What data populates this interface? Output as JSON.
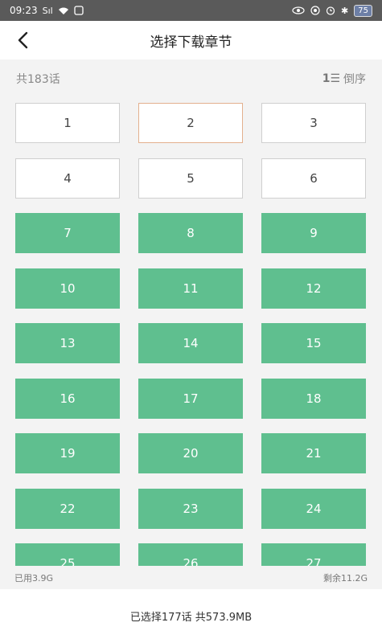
{
  "status_bar": {
    "time": "09:23",
    "signal": "Sıl",
    "battery": "75"
  },
  "header": {
    "title": "选择下载章节"
  },
  "info": {
    "total": "共183话",
    "sort_label": "倒序",
    "sort_icon_text": "1☰"
  },
  "chapters": [
    {
      "label": "1",
      "state": "default"
    },
    {
      "label": "2",
      "state": "selected-outline"
    },
    {
      "label": "3",
      "state": "default"
    },
    {
      "label": "4",
      "state": "default"
    },
    {
      "label": "5",
      "state": "default"
    },
    {
      "label": "6",
      "state": "default"
    },
    {
      "label": "7",
      "state": "downloaded"
    },
    {
      "label": "8",
      "state": "downloaded"
    },
    {
      "label": "9",
      "state": "downloaded"
    },
    {
      "label": "10",
      "state": "downloaded"
    },
    {
      "label": "11",
      "state": "downloaded"
    },
    {
      "label": "12",
      "state": "downloaded"
    },
    {
      "label": "13",
      "state": "downloaded"
    },
    {
      "label": "14",
      "state": "downloaded"
    },
    {
      "label": "15",
      "state": "downloaded"
    },
    {
      "label": "16",
      "state": "downloaded"
    },
    {
      "label": "17",
      "state": "downloaded"
    },
    {
      "label": "18",
      "state": "downloaded"
    },
    {
      "label": "19",
      "state": "downloaded"
    },
    {
      "label": "20",
      "state": "downloaded"
    },
    {
      "label": "21",
      "state": "downloaded"
    },
    {
      "label": "22",
      "state": "downloaded"
    },
    {
      "label": "23",
      "state": "downloaded"
    },
    {
      "label": "24",
      "state": "downloaded"
    },
    {
      "label": "25",
      "state": "downloaded"
    },
    {
      "label": "26",
      "state": "downloaded"
    },
    {
      "label": "27",
      "state": "downloaded"
    }
  ],
  "storage": {
    "used": "已用3.9G",
    "remaining": "剩余11.2G"
  },
  "footer": {
    "summary": "已选择177话 共573.9MB"
  },
  "colors": {
    "downloaded": "#5fbf8f",
    "selected_border": "#e3b08e",
    "status_bar": "#5a5a5a"
  }
}
